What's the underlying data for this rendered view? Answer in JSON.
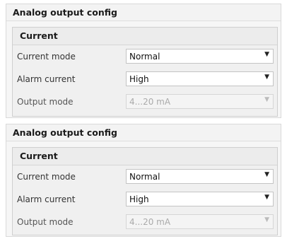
{
  "panels": [
    {
      "title": "Analog output config",
      "group_title": "Current",
      "rows": [
        {
          "label": "Current mode",
          "value": "Normal",
          "enabled": true
        },
        {
          "label": "Alarm current",
          "value": "High",
          "enabled": true
        },
        {
          "label": "Output mode",
          "value": "4...20 mA",
          "enabled": false
        }
      ]
    },
    {
      "title": "Analog output config",
      "group_title": "Current",
      "rows": [
        {
          "label": "Current mode",
          "value": "Normal",
          "enabled": true
        },
        {
          "label": "Alarm current",
          "value": "High",
          "enabled": true
        },
        {
          "label": "Output mode",
          "value": "4...20 mA",
          "enabled": false
        }
      ]
    }
  ],
  "icons": {
    "dropdown": "chevron-down-icon"
  },
  "colors": {
    "disabled_text": "#aaaaaa",
    "panel_bg": "#f6f6f6"
  }
}
